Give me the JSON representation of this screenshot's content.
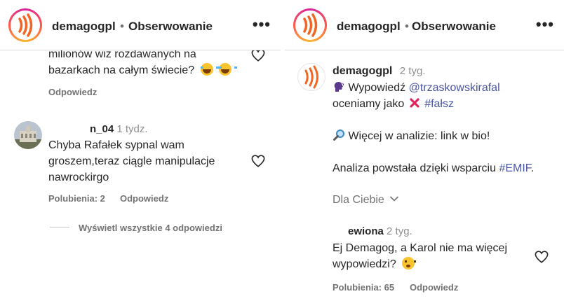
{
  "left_panel": {
    "header": {
      "username": "demagogpl",
      "separator": "•",
      "follow_label": "Obserwowanie",
      "more": "•••"
    },
    "comment1": {
      "text_line1": "milionów wiz rozdawanych na",
      "text_line2": "bazarkach na całym świecie?",
      "reply_label": "Odpowiedz"
    },
    "comment2": {
      "username": "n_04",
      "time": "1 tydz.",
      "text_line1": "Chyba Rafałek sypnal wam",
      "text_line2": "groszem,teraz ciągle manipulacje",
      "text_line3": "nawrockirgo",
      "likes_label": "Polubienia: 2",
      "reply_label": "Odpowiedz"
    },
    "view_replies_label": "Wyświetl wszystkie 4 odpowiedzi"
  },
  "right_panel": {
    "header": {
      "username": "demagogpl",
      "separator": "•",
      "follow_label": "Obserwowanie",
      "more": "•••"
    },
    "post": {
      "username": "demagogpl",
      "time": "2 tyg.",
      "line1_prefix": "Wypowiedź",
      "mention": "@trzaskowskirafal",
      "line2_prefix": "oceniamy jako",
      "hashtag_false": "#fałsz",
      "line3": "Więcej w analizie: link w bio!",
      "line4_prefix": "Analiza powstała dzięki wsparciu",
      "hashtag_emif": "#EMIF",
      "line4_suffix": "."
    },
    "for_you_label": "Dla Ciebie",
    "comment": {
      "username": "ewiona",
      "time": "2 tyg.",
      "text_line1": "Ej Demagog, a Karol nie ma więcej",
      "text_line2": "wypowiedzi?",
      "likes_label": "Polubienia: 65",
      "reply_label": "Odpowiedz"
    }
  },
  "colors": {
    "link": "#4a55a2",
    "muted": "#737373",
    "logo_orange": "#f26522",
    "divider": "#dbdbdb"
  },
  "icons": [
    "demagog-logo-icon",
    "more-options-icon",
    "heart-icon",
    "chevron-down-icon",
    "speaking-head-icon",
    "cross-mark-icon",
    "magnifier-icon",
    "laughing-emoji-icon",
    "thinking-emoji-icon"
  ]
}
